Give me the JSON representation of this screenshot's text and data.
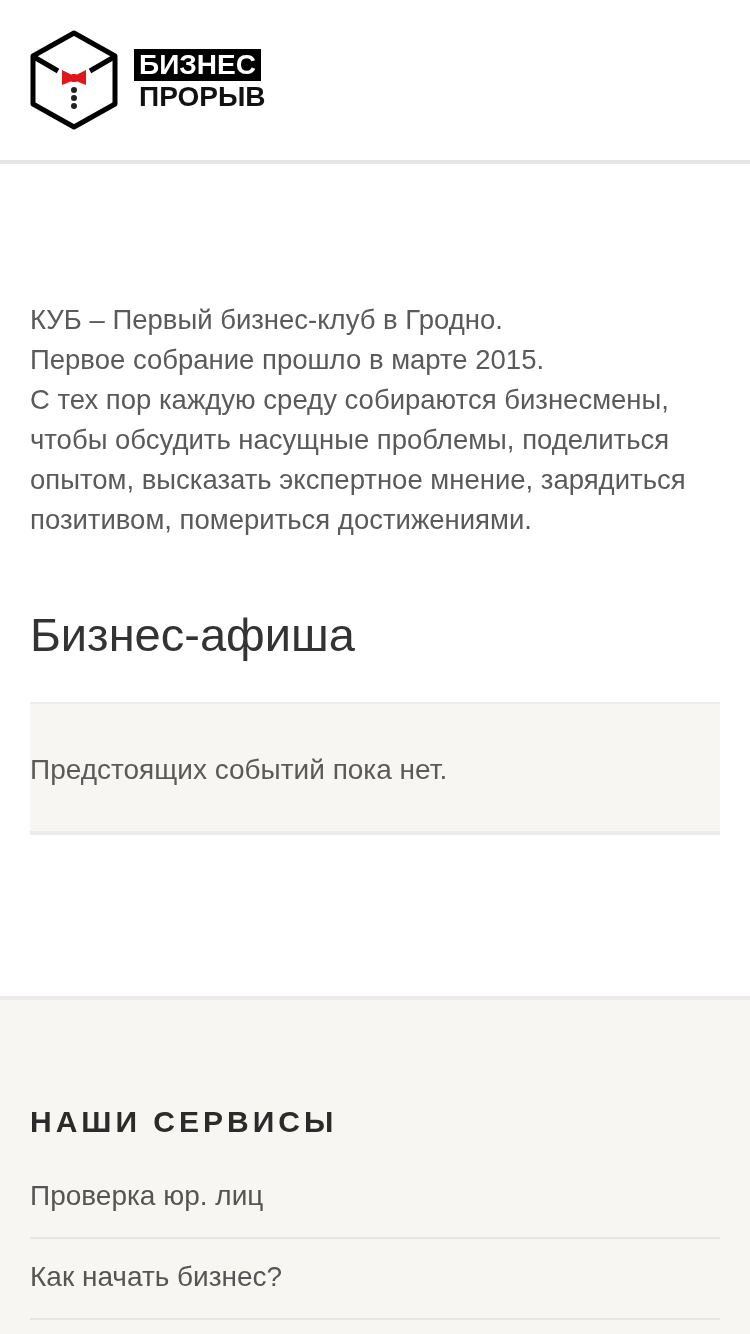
{
  "header": {
    "logo": {
      "line_1": "БИЗНЕС",
      "line_2": "ПРОРЫВ"
    }
  },
  "intro": {
    "text": "КУБ – Первый бизнес-клуб в Гродно.\nПервое собрание прошло в марте 2015.\nС тех пор каждую среду собираются бизнесмены, чтобы обсудить насущные проблемы, поделиться опытом, высказать экспертное мнение, зарядиться позитивом, помериться достижениями."
  },
  "events": {
    "title": "Бизнес-афиша",
    "empty_message": "Предстоящих событий пока нет."
  },
  "footer": {
    "title": "НАШИ СЕРВИСЫ",
    "links": [
      "Проверка юр. лиц",
      "Как начать бизнес?"
    ]
  }
}
